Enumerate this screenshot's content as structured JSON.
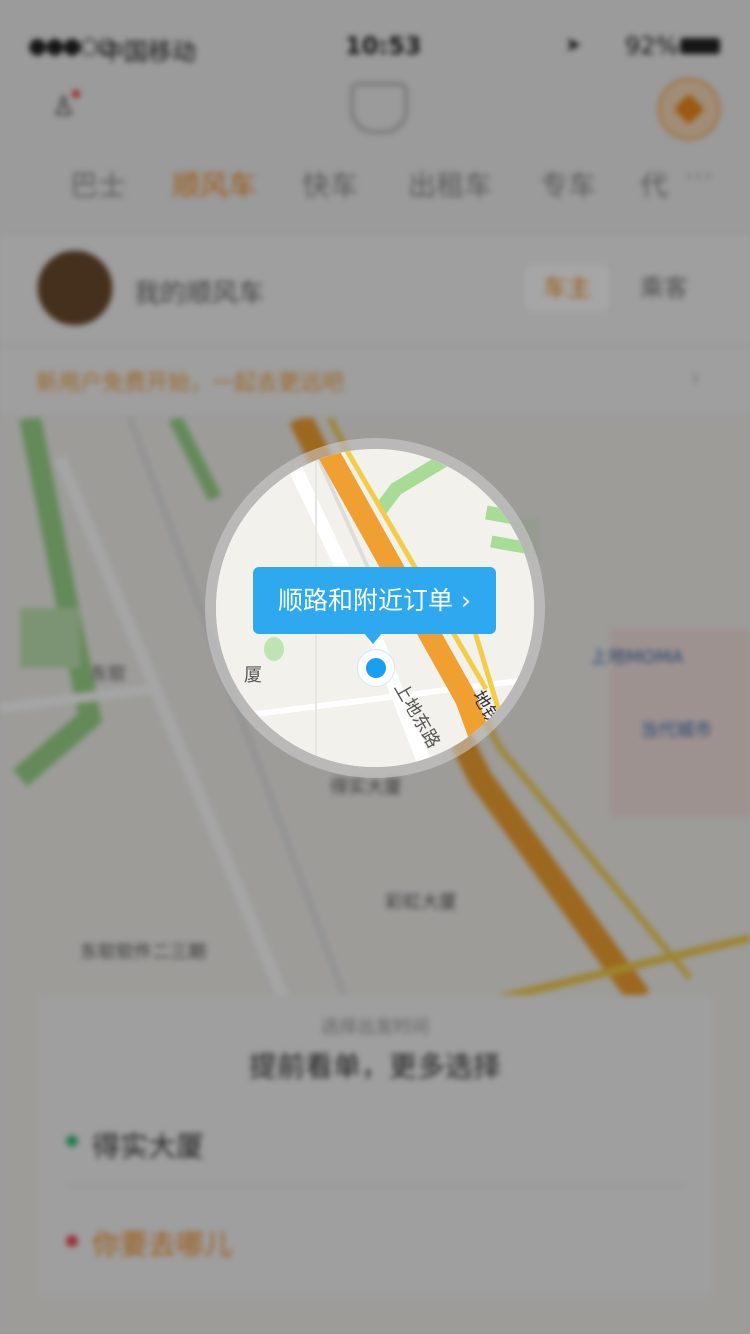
{
  "status_bar": {
    "signal": "●●●○○",
    "carrier": "中国移动",
    "time": "10:53",
    "battery": "92%"
  },
  "tabs": [
    {
      "label": "巴士"
    },
    {
      "label": "顺风车"
    },
    {
      "label": "快车"
    },
    {
      "label": "出租车"
    },
    {
      "label": "专车"
    },
    {
      "label": "代"
    }
  ],
  "tabs_more": "···",
  "card": {
    "my_ride": "我的顺风车",
    "role_owner": "车主",
    "role_passenger": "乘客",
    "promo": "新用户免费开始，一起去更远吧",
    "promo_arrow": "›"
  },
  "map_labels": {
    "building_1": "厦",
    "road_1": "上地东路",
    "road_2": "地铁",
    "building_2": "得实大厦",
    "building_3": "彩虹大厦",
    "building_4": "东软软件二三期",
    "building_5": "上地MOMA",
    "building_6": "当代城市"
  },
  "tooltip": {
    "label": "顺路和附近订单 ›"
  },
  "bottom_sheet": {
    "subtitle": "选择出发时间",
    "title": "提前看单，更多选择",
    "from": "得实大厦",
    "to": "你要去哪儿"
  },
  "colors": {
    "accent": "#f08a20",
    "tooltip": "#2ea8ee",
    "location": "#1a9ef0"
  }
}
